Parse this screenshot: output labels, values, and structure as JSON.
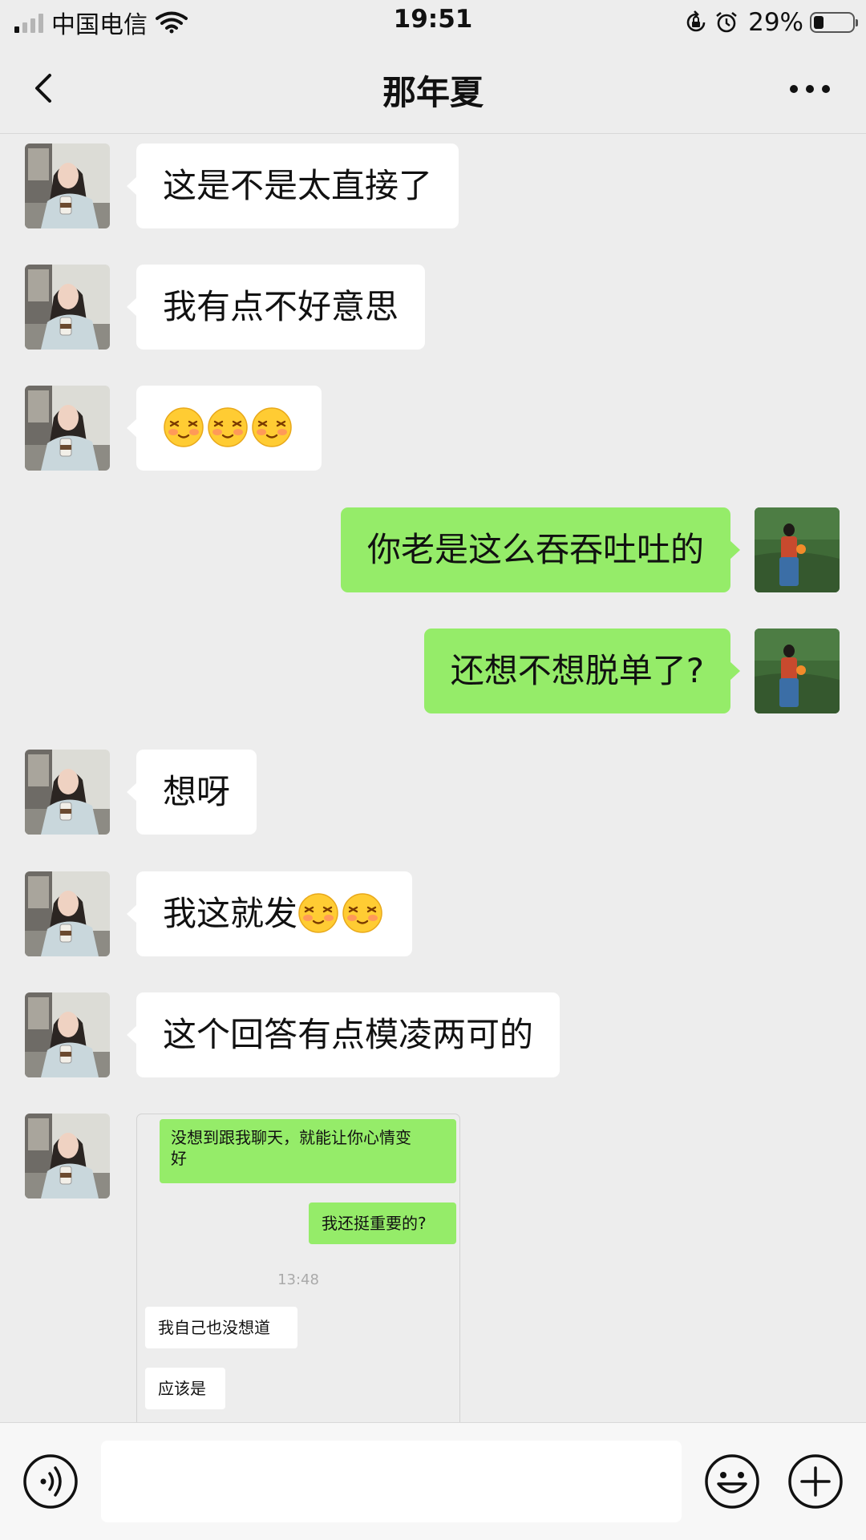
{
  "status_bar": {
    "carrier": "中国电信",
    "time": "19:51",
    "battery_percent": "29%",
    "signal_bars_active": 1,
    "icons": [
      "signal-icon",
      "wifi-icon",
      "rotation-lock-icon",
      "alarm-icon",
      "battery-icon"
    ]
  },
  "header": {
    "title": "那年夏",
    "back_icon": "chevron-left-icon",
    "more_icon": "more-dots-icon"
  },
  "messages": [
    {
      "side": "in",
      "text": "这是不是太直接了",
      "emoji_count": 0
    },
    {
      "side": "in",
      "text": "我有点不好意思",
      "emoji_count": 0
    },
    {
      "side": "in",
      "text": "",
      "emoji_count": 3,
      "emoji": "shy-face-emoji"
    },
    {
      "side": "out",
      "text": "你老是这么吞吞吐吐的",
      "emoji_count": 0
    },
    {
      "side": "out",
      "text": "还想不想脱单了?",
      "emoji_count": 0
    },
    {
      "side": "in",
      "text": "想呀",
      "emoji_count": 0
    },
    {
      "side": "in",
      "text": "我这就发",
      "emoji_count": 2,
      "emoji": "shy-face-emoji"
    },
    {
      "side": "in",
      "text": "这个回答有点模凌两可的",
      "emoji_count": 0
    }
  ],
  "image_message": {
    "side": "in",
    "screenshot": {
      "msg1": "没想到跟我聊天，就能让你心情变",
      "msg1_line2": "好",
      "msg2": "我还挺重要的?",
      "time": "13:48",
      "msg3": "我自己也没想道",
      "msg4": "应该是"
    }
  },
  "input_bar": {
    "value": "",
    "icons": [
      "voice-icon",
      "emoji-icon",
      "plus-icon"
    ]
  },
  "colors": {
    "background": "#ededed",
    "out_bubble": "#95ec69",
    "in_bubble": "#ffffff",
    "input_bar": "#f7f7f7"
  }
}
